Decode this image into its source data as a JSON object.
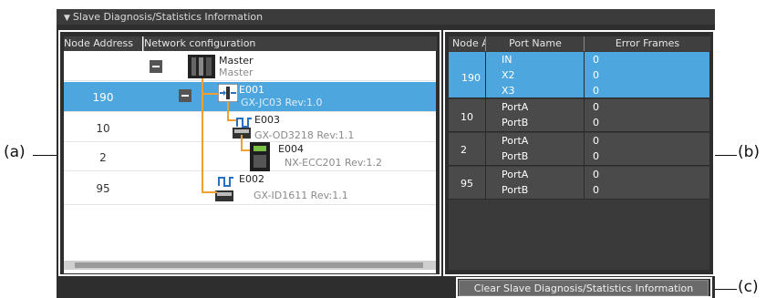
{
  "panel": {
    "title": "Slave Diagnosis/Statistics Information",
    "collapse_glyph": "▼"
  },
  "callouts": {
    "a": "(a)",
    "b": "(b)",
    "c": "(c)"
  },
  "left_table": {
    "headers": [
      "Node Address",
      "Network configuration"
    ],
    "master": {
      "name": "Master",
      "sub": "Master"
    },
    "rows": [
      {
        "node": "190",
        "name": "E001",
        "model": "GX-JC03 Rev:1.0",
        "selected": true
      },
      {
        "node": "10",
        "name": "E003",
        "model": "GX-OD3218 Rev:1.1",
        "selected": false
      },
      {
        "node": "2",
        "name": "E004",
        "model": "NX-ECC201 Rev:1.2",
        "selected": false
      },
      {
        "node": "95",
        "name": "E002",
        "model": "GX-ID1611 Rev:1.1",
        "selected": false
      }
    ]
  },
  "right_table": {
    "headers": [
      "Node A",
      "Port Name",
      "Error Frames"
    ],
    "groups": [
      {
        "node": "190",
        "selected": true,
        "ports": [
          {
            "port": "IN",
            "errors": "0"
          },
          {
            "port": "X2",
            "errors": "0"
          },
          {
            "port": "X3",
            "errors": "0"
          }
        ]
      },
      {
        "node": "10",
        "selected": false,
        "ports": [
          {
            "port": "PortA",
            "errors": "0"
          },
          {
            "port": "PortB",
            "errors": "0"
          }
        ]
      },
      {
        "node": "2",
        "selected": false,
        "ports": [
          {
            "port": "PortA",
            "errors": "0"
          },
          {
            "port": "PortB",
            "errors": "0"
          }
        ]
      },
      {
        "node": "95",
        "selected": false,
        "ports": [
          {
            "port": "PortA",
            "errors": "0"
          },
          {
            "port": "PortB",
            "errors": "0"
          }
        ]
      }
    ]
  },
  "clear_button": {
    "label": "Clear Slave Diagnosis/Statistics Information"
  },
  "colors": {
    "selected": "#4ea6df",
    "wire": "#f0a030",
    "panel": "#2e2e2e"
  }
}
